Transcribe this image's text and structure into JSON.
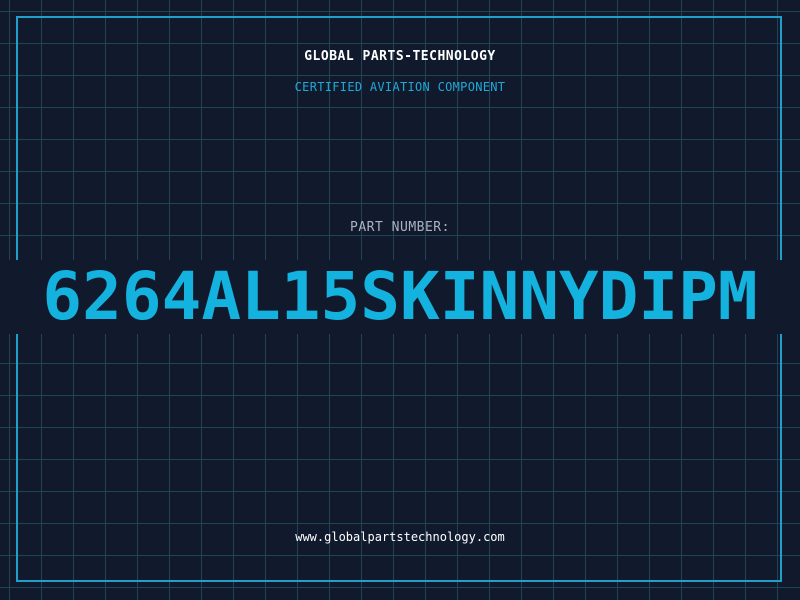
{
  "header": {
    "brand": "GLOBAL PARTS-TECHNOLOGY",
    "subtitle": "CERTIFIED AVIATION COMPONENT"
  },
  "part": {
    "label": "PART NUMBER:",
    "number": "6264AL15SKINNYDIPM"
  },
  "footer": {
    "website": "www.globalpartstechnology.com"
  },
  "colors": {
    "background": "#111a2d",
    "grid": "#1f4458",
    "accent": "#14b2de",
    "frame": "#1f9fc9"
  }
}
